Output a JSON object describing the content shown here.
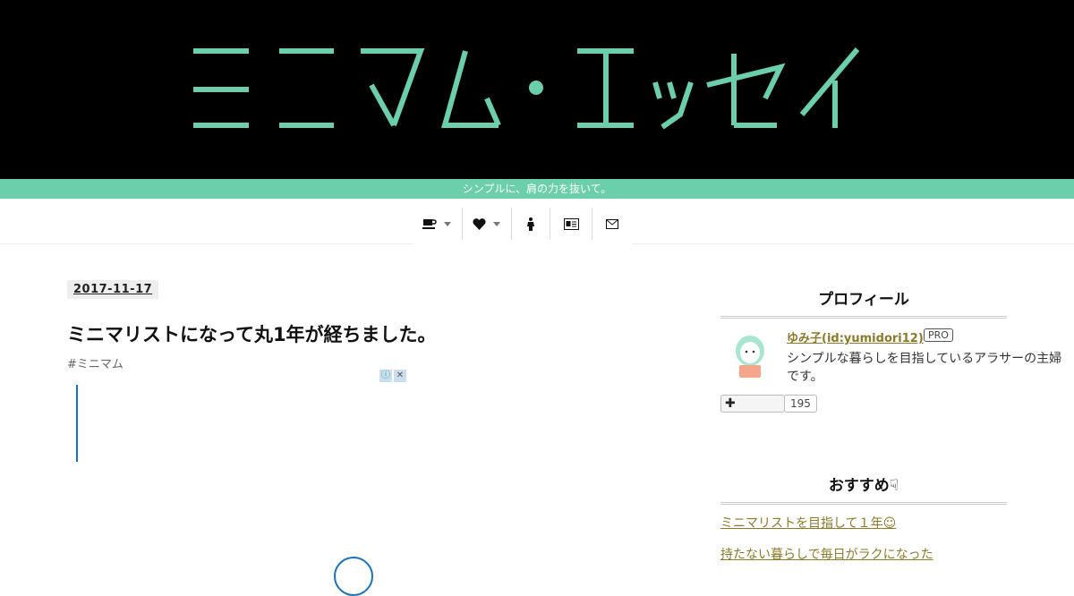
{
  "header": {
    "logo_text": "ミニマム・エッセイ",
    "tagline": "シンプルに、肩の力を抜いて。"
  },
  "nav": {
    "items": [
      {
        "icon": "coffee-icon",
        "has_dropdown": true
      },
      {
        "icon": "heart-icon",
        "has_dropdown": true
      },
      {
        "icon": "person-icon",
        "has_dropdown": false
      },
      {
        "icon": "id-card-icon",
        "has_dropdown": false
      },
      {
        "icon": "envelope-icon",
        "has_dropdown": false
      }
    ]
  },
  "article": {
    "date": "2017-11-17",
    "title": "ミニマリストになって丸1年が経ちました。",
    "category": "#ミニマム"
  },
  "sidebar": {
    "profile_heading": "プロフィール",
    "profile_name": "ゆみ子(id:yumidori12)",
    "pro_badge": "PRO",
    "profile_desc": "シンプルな暮らしを目指しているアラサーの主婦です。",
    "follow_count": "195",
    "section2_heading": "おすすめ☟",
    "links": [
      "ミニマリストを目指して１年☺",
      "持たない暮らしで毎日がラクになった"
    ]
  },
  "colors": {
    "accent": "#6ccfac",
    "header_bg": "#000000",
    "link": "#8a7a2a"
  }
}
